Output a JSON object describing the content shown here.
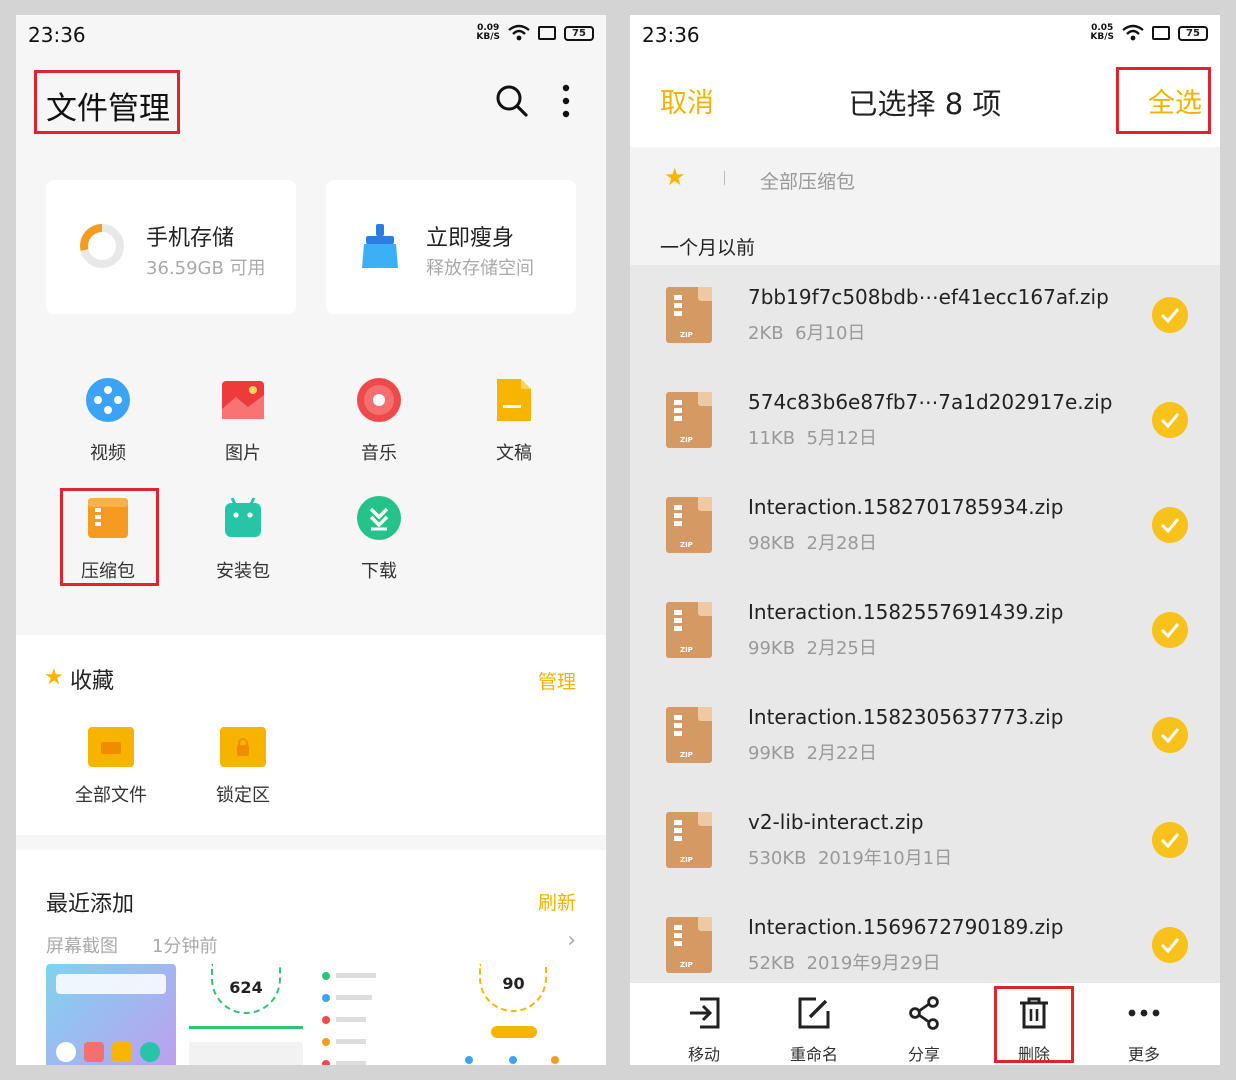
{
  "left": {
    "status": {
      "time": "23:36",
      "speed_value": "0.09",
      "speed_unit": "KB/S",
      "battery": "75"
    },
    "title": "文件管理",
    "cards": [
      {
        "title": "手机存储",
        "subtitle": "36.59GB 可用"
      },
      {
        "title": "立即瘦身",
        "subtitle": "释放存储空间"
      }
    ],
    "categories": [
      {
        "label": "视频",
        "icon": "video-icon",
        "color": "#3aa3f5"
      },
      {
        "label": "图片",
        "icon": "picture-icon",
        "color": "#ee3a3a"
      },
      {
        "label": "音乐",
        "icon": "music-icon",
        "color": "#ef4a4a"
      },
      {
        "label": "文稿",
        "icon": "document-icon",
        "color": "#f7b500"
      },
      {
        "label": "压缩包",
        "icon": "archive-icon",
        "color": "#f79a20"
      },
      {
        "label": "安装包",
        "icon": "android-icon",
        "color": "#26c5a8"
      },
      {
        "label": "下载",
        "icon": "download-icon",
        "color": "#25c28a"
      }
    ],
    "favorites": {
      "title": "收藏",
      "action": "管理",
      "items": [
        {
          "label": "全部文件",
          "icon": "folder-icon"
        },
        {
          "label": "锁定区",
          "icon": "lock-folder-icon"
        }
      ]
    },
    "recent": {
      "title": "最近添加",
      "action": "刷新",
      "subtitle": "屏幕截图",
      "time": "1分钟前",
      "thumb_labels": [
        "624",
        "90"
      ]
    }
  },
  "right": {
    "status": {
      "time": "23:36",
      "speed_value": "0.05",
      "speed_unit": "KB/S",
      "battery": "75"
    },
    "cancel": "取消",
    "title": "已选择 8 项",
    "select_all": "全选",
    "crumb": "全部压缩包",
    "group": "一个月以前",
    "files": [
      {
        "name": "7bb19f7c508bdb⋯ef41ecc167af.zip",
        "size": "2KB",
        "date": "6月10日"
      },
      {
        "name": "574c83b6e87fb7⋯7a1d202917e.zip",
        "size": "11KB",
        "date": "5月12日"
      },
      {
        "name": "Interaction.1582701785934.zip",
        "size": "98KB",
        "date": "2月28日"
      },
      {
        "name": "Interaction.1582557691439.zip",
        "size": "99KB",
        "date": "2月25日"
      },
      {
        "name": "Interaction.1582305637773.zip",
        "size": "99KB",
        "date": "2月22日"
      },
      {
        "name": "v2-lib-interact.zip",
        "size": "530KB",
        "date": "2019年10月1日"
      },
      {
        "name": "Interaction.1569672790189.zip",
        "size": "52KB",
        "date": "2019年9月29日"
      }
    ],
    "zip_label": "ZIP",
    "toolbar": [
      {
        "label": "移动",
        "icon": "move-icon"
      },
      {
        "label": "重命名",
        "icon": "rename-icon"
      },
      {
        "label": "分享",
        "icon": "share-icon"
      },
      {
        "label": "删除",
        "icon": "delete-icon"
      },
      {
        "label": "更多",
        "icon": "more-icon"
      }
    ]
  },
  "colors": {
    "accent": "#f0b400",
    "highlight": "#e0232e",
    "check": "#f7c21c"
  }
}
